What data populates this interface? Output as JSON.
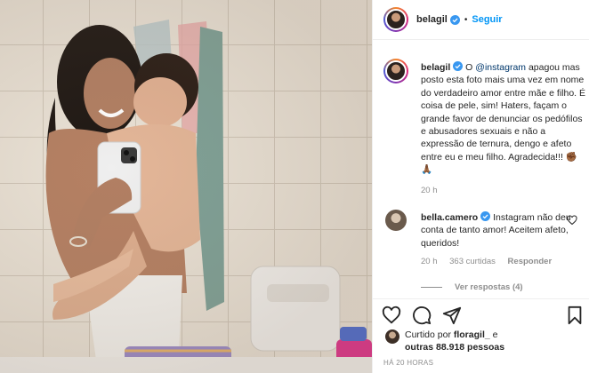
{
  "header": {
    "username": "belagil",
    "separator": "•",
    "follow_label": "Seguir"
  },
  "caption": {
    "username": "belagil",
    "text_before": " O ",
    "mention": "@instagram",
    "text_after": " apagou mas posto esta foto mais uma vez em nome do verdadeiro amor entre mãe e filho. É coisa de pele, sim! Haters, façam o grande favor de denunciar os pedófilos e abusadores sexuais e não a expressão de ternura, dengo e afeto entre eu e meu filho. Agradecida!!! ✊🏾🙏🏾",
    "time": "20 h"
  },
  "comment": {
    "username": "bella.camero",
    "text": " Instagram não deu conta de tanto amor! Aceitem afeto, queridos!",
    "time": "20 h",
    "likes": "363 curtidas",
    "reply_label": "Responder",
    "view_replies": "Ver respostas (4)"
  },
  "likes": {
    "prefix": "Curtido por ",
    "user": "floragil_",
    "middle": " e ",
    "others": "outras 88.918 pessoas"
  },
  "posted_ago": "HÁ 20 HORAS",
  "colors": {
    "accent_blue": "#0095f6",
    "mention_blue": "#00376b",
    "muted": "#8e8e8e",
    "text": "#262626"
  },
  "icons": [
    "verified-badge-icon",
    "heart-icon",
    "comment-icon",
    "share-icon",
    "bookmark-icon"
  ]
}
